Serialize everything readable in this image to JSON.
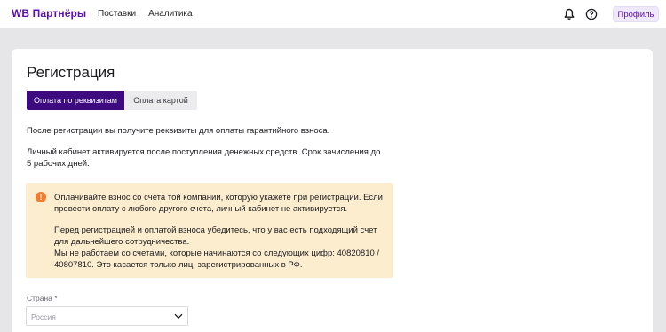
{
  "header": {
    "logo": "WB Партнёры",
    "nav": [
      "Поставки",
      "Аналитика"
    ],
    "profile_label": "Профиль",
    "icons": [
      "bell-icon",
      "help-icon"
    ]
  },
  "page": {
    "title": "Регистрация",
    "tabs": [
      {
        "label": "Оплата по реквизитам",
        "active": true
      },
      {
        "label": "Оплата картой",
        "active": false
      }
    ],
    "paragraph1": "После регистрации вы получите реквизиты для оплаты гарантийного взноса.",
    "paragraph2": "Личный кабинет активируется после поступления денежных средств. Срок зачисления до 5 рабочих дней."
  },
  "warning": {
    "icon": "!",
    "line1": "Оплачивайте взнос со счета той компании, которую укажете при регистрации. Если провести оплату с любого другого счета, личный кабинет не активируется.",
    "line2": "Перед регистрацией и оплатой взноса убедитесь, что у вас есть подходящий счет для дальнейшего сотрудничества.",
    "line3": "Мы не работаем со счетами, которые начинаются со следующих цифр: 40820810 / 40807810. Это касается только лиц, зарегистрированных в РФ."
  },
  "country": {
    "label": "Страна",
    "required_mark": "*",
    "placeholder": "Россия"
  },
  "colors": {
    "brand": "#5a0fb0",
    "tab_active": "#3e0a80",
    "warning_bg": "#fdedcf",
    "warning_icon": "#f3792b"
  }
}
